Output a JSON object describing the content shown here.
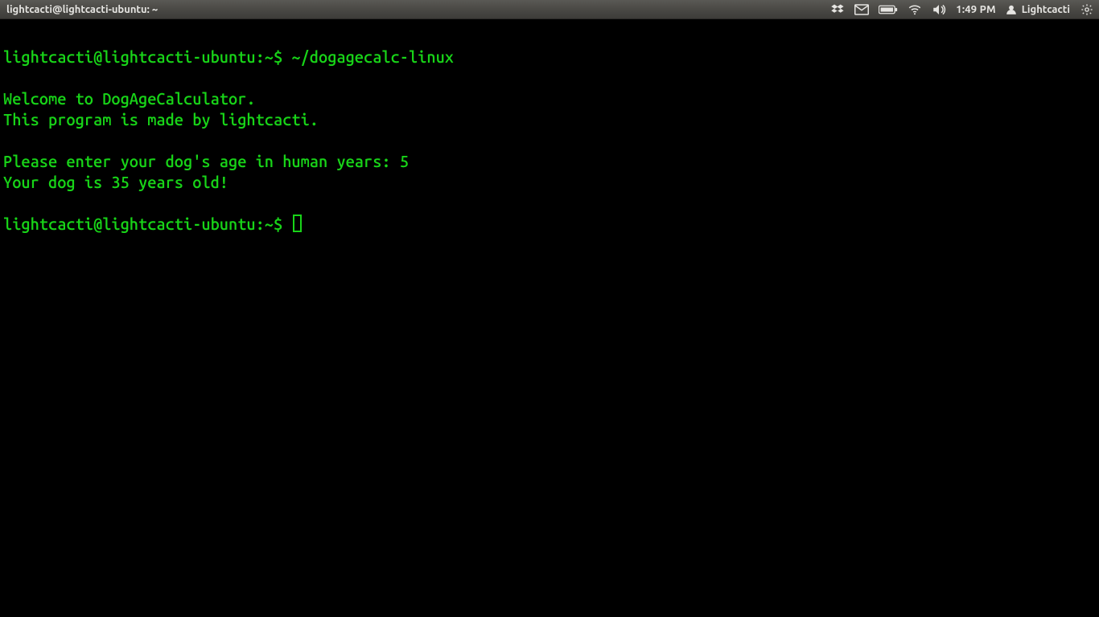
{
  "panel": {
    "title": "lightcacti@lightcacti-ubuntu: ~",
    "time": "1:49 PM",
    "username": "Lightcacti"
  },
  "terminal": {
    "prompt": "lightcacti@lightcacti-ubuntu:~$ ",
    "command": "~/dogagecalc-linux",
    "output": {
      "welcome": "Welcome to DogAgeCalculator.",
      "credit": "This program is made by lightcacti.",
      "ask": "Please enter your dog's age in human years: ",
      "input_value": "5",
      "result": "Your dog is 35 years old!"
    },
    "prompt2": "lightcacti@lightcacti-ubuntu:~$ "
  }
}
